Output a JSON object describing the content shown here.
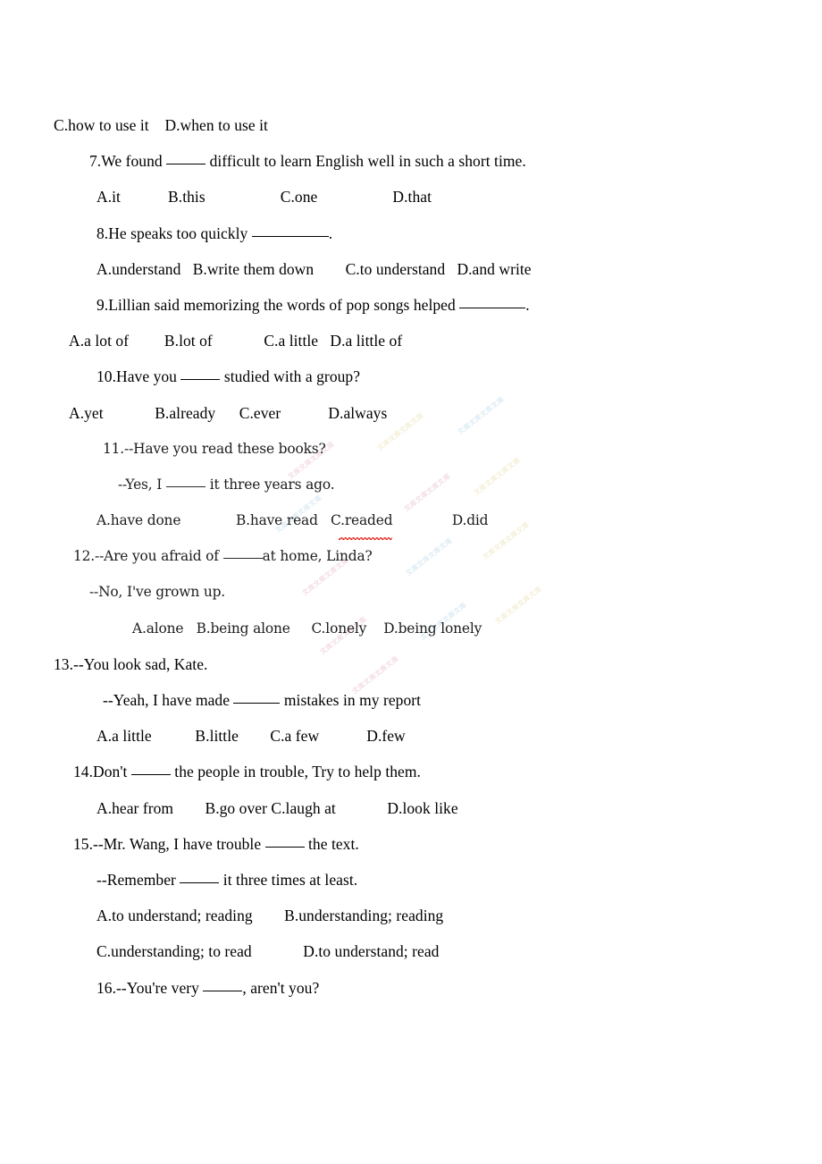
{
  "document": {
    "type": "english-grammar-multiple-choice-worksheet",
    "page_background": "#ffffff",
    "text_color": "#000000",
    "spellcheck_underline_color": "#e2231a",
    "watermark_text": "文库"
  },
  "lines": {
    "l01_q6_options_cd": {
      "a": "C.how to use it",
      "b": "D.when to use it"
    },
    "l02_q7_stem": {
      "pre": "7.We found ",
      "post": " difficult to learn English well in such a short time."
    },
    "l03_q7_options": {
      "a": "A.it",
      "b": "B.this",
      "c": "C.one",
      "d": "D.that"
    },
    "l04_q8_stem": {
      "pre": "8.He speaks too quickly ",
      "post": "."
    },
    "l05_q8_options": {
      "a": "A.understand",
      "b": "B.write them down",
      "c": "C.to understand",
      "d": "D.and write"
    },
    "l06_q9_stem": {
      "pre": "9.Lillian said memorizing the words of pop songs helped ",
      "post": "."
    },
    "l07_q9_options": {
      "a": "A.a lot of",
      "b": "B.lot of",
      "c": "C.a little",
      "d": "D.a little of"
    },
    "l08_q10_stem": {
      "pre": "10.Have you ",
      "post": " studied with a group?"
    },
    "l09_q10_options": {
      "a": "A.yet",
      "b": "B.already",
      "c": "C.ever",
      "d": "D.always"
    },
    "l10_q11_stem": {
      "text": "11.--Have you read these books?"
    },
    "l11_q11_reply": {
      "pre": "--Yes, I ",
      "post": " it three years ago."
    },
    "l12_q11_options": {
      "a": "A.have done",
      "b": "B.have read",
      "c_prefix": "C.",
      "c_word": "readed",
      "d": "D.did"
    },
    "l13_q12_stem": {
      "pre": "12.--Are you afraid of ",
      "post": "at home, Linda?"
    },
    "l14_q12_reply": {
      "text": "--No, I've grown up."
    },
    "l15_q12_options": {
      "a": "A.alone",
      "b": "B.being alone",
      "c": "C.lonely",
      "d": "D.being lonely"
    },
    "l16_q13_stem": {
      "text": "13.--You look sad, Kate."
    },
    "l17_q13_reply": {
      "pre": "--Yeah, I have made ",
      "post": " mistakes in my report"
    },
    "l18_q13_options": {
      "a": "A.a little",
      "b": "B.little",
      "c": "C.a few",
      "d": "D.few"
    },
    "l19_q14_stem": {
      "pre": "14.Don't ",
      "post": " the people in trouble, Try to help them."
    },
    "l20_q14_options": {
      "a": "A.hear from",
      "b": "B.go over",
      "c": "C.laugh at",
      "d": "D.look like"
    },
    "l21_q15_stem": {
      "pre": "15.--Mr. Wang, I have trouble ",
      "post": " the text."
    },
    "l22_q15_reply": {
      "pre": "--Remember ",
      "post": " it three times at least."
    },
    "l23_q15_options_ab": {
      "a": "A.to understand; reading",
      "b": "B.understanding; reading"
    },
    "l24_q15_options_cd": {
      "c": "C.understanding; to read",
      "d": "D.to understand; read"
    },
    "l25_q16_stem": {
      "pre": "16.--You're very ",
      "post": ", aren't you?"
    }
  }
}
